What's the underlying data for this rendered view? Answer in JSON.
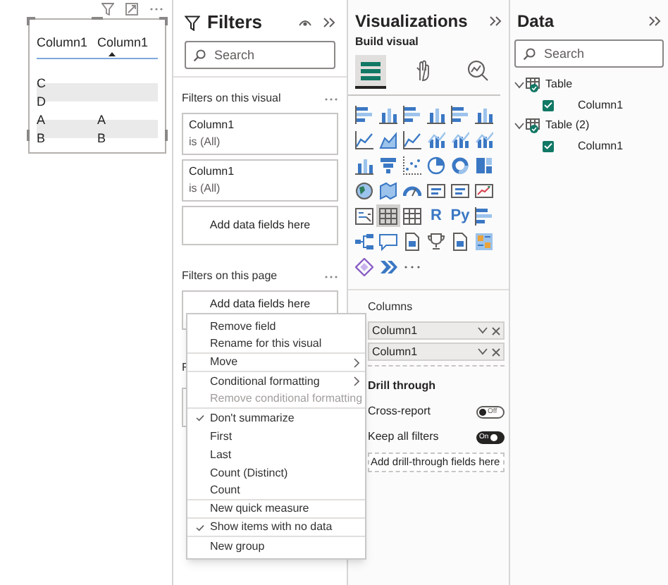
{
  "canvas": {
    "table_visual": {
      "columns": [
        {
          "label": "Column1",
          "sorted": false
        },
        {
          "label": "Column1",
          "sorted": true
        }
      ],
      "rows": [
        {
          "column_1": "C"
        },
        {
          "column_1": "D"
        },
        {
          "column_1": "A",
          "column_2": "A"
        },
        {
          "column_1": "B",
          "column_2": "B"
        }
      ]
    }
  },
  "filters_pane": {
    "title": "Filters",
    "search": {
      "placeholder": "Search"
    },
    "visual_section": {
      "title": "Filters on this visual",
      "cards": [
        {
          "field": "Column1",
          "summary": "is (All)"
        },
        {
          "field": "Column1",
          "summary": "is (All)"
        }
      ],
      "drop_hint": "Add data fields here"
    },
    "page_section": {
      "title": "Filters on this page",
      "drop_hint": "Add data fields here"
    },
    "all_pages_section": {
      "title": "F"
    }
  },
  "visualizations_pane": {
    "title": "Visualizations",
    "subtitle": "Build visual",
    "build_tabs": [
      {
        "kind": "fields",
        "selected": true
      },
      {
        "kind": "format",
        "selected": false
      },
      {
        "kind": "analytics",
        "selected": false
      }
    ],
    "gallery": [
      {
        "kind": "hbar",
        "selected": false
      },
      {
        "kind": "column",
        "selected": false
      },
      {
        "kind": "hbar",
        "selected": false
      },
      {
        "kind": "column",
        "selected": false
      },
      {
        "kind": "hbar",
        "selected": false
      },
      {
        "kind": "column",
        "selected": false
      },
      {
        "kind": "line",
        "selected": false
      },
      {
        "kind": "area",
        "selected": false
      },
      {
        "kind": "line",
        "selected": false
      },
      {
        "kind": "combo",
        "selected": false
      },
      {
        "kind": "combo",
        "selected": false
      },
      {
        "kind": "combo",
        "selected": false
      },
      {
        "kind": "column",
        "selected": false
      },
      {
        "kind": "funnel",
        "selected": false
      },
      {
        "kind": "scatter",
        "selected": false
      },
      {
        "kind": "pie",
        "selected": false
      },
      {
        "kind": "donut",
        "selected": false
      },
      {
        "kind": "treemap",
        "selected": false
      },
      {
        "kind": "globe",
        "selected": false
      },
      {
        "kind": "map",
        "selected": false
      },
      {
        "kind": "gauge",
        "selected": false
      },
      {
        "kind": "card",
        "selected": false
      },
      {
        "kind": "card",
        "selected": false
      },
      {
        "kind": "kpi",
        "selected": false
      },
      {
        "kind": "slicer",
        "selected": false
      },
      {
        "kind": "table",
        "selected": true
      },
      {
        "kind": "table",
        "selected": false
      },
      {
        "kind": "text",
        "label": "R",
        "selected": false
      },
      {
        "kind": "text",
        "label": "Py",
        "selected": false
      },
      {
        "kind": "hbar",
        "selected": false
      },
      {
        "kind": "tree",
        "selected": false
      },
      {
        "kind": "speech",
        "selected": false
      },
      {
        "kind": "doc",
        "selected": false
      },
      {
        "kind": "trophy",
        "selected": false
      },
      {
        "kind": "doc",
        "selected": false
      },
      {
        "kind": "app",
        "selected": false
      },
      {
        "kind": "diamond",
        "selected": false
      },
      {
        "kind": "chevrons",
        "selected": false
      },
      {
        "kind": "more",
        "selected": false
      }
    ],
    "columns_label": "Columns",
    "column_wells": [
      "Column1",
      "Column1"
    ],
    "drill_through": {
      "title": "Drill through",
      "toggles": [
        {
          "label": "Cross-report",
          "on": false,
          "state_text": "Off"
        },
        {
          "label": "Keep all filters",
          "on": true,
          "state_text": "On"
        }
      ],
      "drop_hint": "Add drill-through fields here"
    }
  },
  "data_pane": {
    "title": "Data",
    "search": {
      "placeholder": "Search"
    },
    "tables": [
      {
        "name": "Table",
        "expanded": true,
        "children": [
          {
            "name": "Column1",
            "checked": true
          }
        ]
      },
      {
        "name": "Table (2)",
        "expanded": true,
        "children": [
          {
            "name": "Column1",
            "checked": true
          }
        ]
      }
    ]
  },
  "context_menu": {
    "items": [
      {
        "label": "Remove field",
        "disabled": false,
        "checked": false,
        "submenu": false,
        "divider_after": false
      },
      {
        "label": "Rename for this visual",
        "disabled": false,
        "checked": false,
        "submenu": false,
        "divider_after": true
      },
      {
        "label": "Move",
        "disabled": false,
        "checked": false,
        "submenu": true,
        "divider_after": true
      },
      {
        "label": "Conditional formatting",
        "disabled": false,
        "checked": false,
        "submenu": true,
        "divider_after": false
      },
      {
        "label": "Remove conditional formatting",
        "disabled": true,
        "checked": false,
        "submenu": false,
        "divider_after": true
      },
      {
        "label": "Don't summarize",
        "disabled": false,
        "checked": true,
        "submenu": false,
        "divider_after": false
      },
      {
        "label": "First",
        "disabled": false,
        "checked": false,
        "submenu": false,
        "divider_after": false
      },
      {
        "label": "Last",
        "disabled": false,
        "checked": false,
        "submenu": false,
        "divider_after": false
      },
      {
        "label": "Count (Distinct)",
        "disabled": false,
        "checked": false,
        "submenu": false,
        "divider_after": false
      },
      {
        "label": "Count",
        "disabled": false,
        "checked": false,
        "submenu": false,
        "divider_after": true
      },
      {
        "label": "New quick measure",
        "disabled": false,
        "checked": false,
        "submenu": false,
        "divider_after": true
      },
      {
        "label": "Show items with no data",
        "disabled": false,
        "checked": true,
        "submenu": false,
        "divider_after": true
      },
      {
        "label": "New group",
        "disabled": false,
        "checked": false,
        "submenu": false,
        "divider_after": false
      }
    ]
  }
}
